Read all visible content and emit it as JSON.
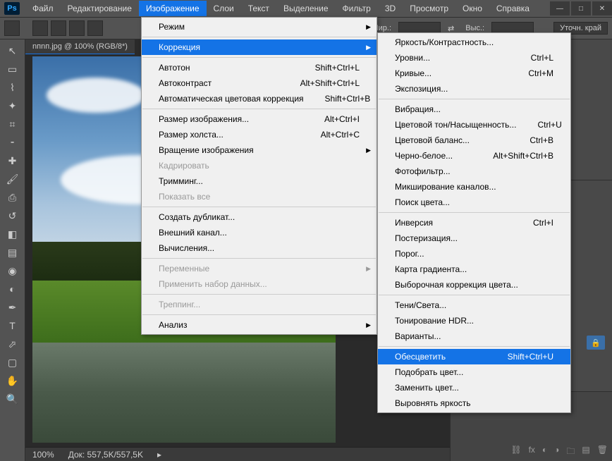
{
  "app": {
    "logo": "Ps"
  },
  "menubar": [
    "Файл",
    "Редактирование",
    "Изображение",
    "Слои",
    "Текст",
    "Выделение",
    "Фильтр",
    "3D",
    "Просмотр",
    "Окно",
    "Справка"
  ],
  "menubar_active_index": 2,
  "options_bar": {
    "width_label": "Шир.:",
    "height_label": "Выс.:",
    "refine": "Уточн. край"
  },
  "doc": {
    "tab": "nпnп.jpg @ 100% (RGB/8*)",
    "zoom": "100%",
    "docsize": "Док: 557,5K/557,5K"
  },
  "menu_image": {
    "groups": [
      [
        {
          "label": "Режим",
          "arrow": true
        }
      ],
      [
        {
          "label": "Коррекция",
          "arrow": true,
          "hl": true
        }
      ],
      [
        {
          "label": "Автотон",
          "shortcut": "Shift+Ctrl+L"
        },
        {
          "label": "Автоконтраст",
          "shortcut": "Alt+Shift+Ctrl+L"
        },
        {
          "label": "Автоматическая цветовая коррекция",
          "shortcut": "Shift+Ctrl+B"
        }
      ],
      [
        {
          "label": "Размер изображения...",
          "shortcut": "Alt+Ctrl+I"
        },
        {
          "label": "Размер холста...",
          "shortcut": "Alt+Ctrl+C"
        },
        {
          "label": "Вращение изображения",
          "arrow": true
        },
        {
          "label": "Кадрировать",
          "disabled": true
        },
        {
          "label": "Тримминг..."
        },
        {
          "label": "Показать все",
          "disabled": true
        }
      ],
      [
        {
          "label": "Создать дубликат..."
        },
        {
          "label": "Внешний канал..."
        },
        {
          "label": "Вычисления..."
        }
      ],
      [
        {
          "label": "Переменные",
          "arrow": true,
          "disabled": true
        },
        {
          "label": "Применить набор данных...",
          "disabled": true
        }
      ],
      [
        {
          "label": "Треппинг...",
          "disabled": true
        }
      ],
      [
        {
          "label": "Анализ",
          "arrow": true
        }
      ]
    ]
  },
  "menu_adjust": {
    "groups": [
      [
        {
          "label": "Яркость/Контрастность..."
        },
        {
          "label": "Уровни...",
          "shortcut": "Ctrl+L"
        },
        {
          "label": "Кривые...",
          "shortcut": "Ctrl+M"
        },
        {
          "label": "Экспозиция..."
        }
      ],
      [
        {
          "label": "Вибрация..."
        },
        {
          "label": "Цветовой тон/Насыщенность...",
          "shortcut": "Ctrl+U"
        },
        {
          "label": "Цветовой баланс...",
          "shortcut": "Ctrl+B"
        },
        {
          "label": "Черно-белое...",
          "shortcut": "Alt+Shift+Ctrl+B"
        },
        {
          "label": "Фотофильтр..."
        },
        {
          "label": "Микширование каналов..."
        },
        {
          "label": "Поиск цвета..."
        }
      ],
      [
        {
          "label": "Инверсия",
          "shortcut": "Ctrl+I"
        },
        {
          "label": "Постеризация..."
        },
        {
          "label": "Порог..."
        },
        {
          "label": "Карта градиента..."
        },
        {
          "label": "Выборочная коррекция цвета..."
        }
      ],
      [
        {
          "label": "Тени/Света..."
        },
        {
          "label": "Тонирование HDR..."
        },
        {
          "label": "Варианты..."
        }
      ],
      [
        {
          "label": "Обесцветить",
          "shortcut": "Shift+Ctrl+U",
          "hl": true
        },
        {
          "label": "Подобрать цвет..."
        },
        {
          "label": "Заменить цвет..."
        },
        {
          "label": "Выровнять яркость"
        }
      ]
    ]
  },
  "tools": [
    "move",
    "marquee",
    "lasso",
    "wand",
    "crop",
    "eyedropper",
    "healing",
    "brush",
    "stamp",
    "history-brush",
    "eraser",
    "gradient",
    "blur",
    "dodge",
    "pen",
    "type",
    "path-select",
    "rectangle",
    "hand",
    "zoom"
  ]
}
